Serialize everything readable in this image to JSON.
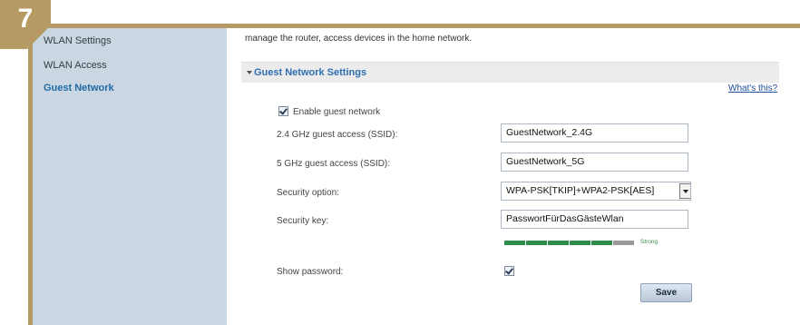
{
  "step_badge": "7",
  "sidebar": {
    "items": [
      {
        "label": "WLAN Settings"
      },
      {
        "label": "WLAN Access"
      },
      {
        "label": "Guest Network"
      }
    ]
  },
  "main": {
    "intro_text": "manage the router, access devices in the home network.",
    "section_title": "Guest Network Settings",
    "help_link": "What's this?",
    "enable_guest": {
      "label": "Enable guest network",
      "checked": true
    },
    "ssid_24": {
      "label": "2.4 GHz guest access (SSID):",
      "value": "GuestNetwork_2.4G"
    },
    "ssid_5": {
      "label": "5 GHz guest access (SSID):",
      "value": "GuestNetwork_5G"
    },
    "security_option": {
      "label": "Security option:",
      "value": "WPA-PSK[TKIP]+WPA2-PSK[AES]"
    },
    "security_key": {
      "label": "Security key:",
      "value": "PasswortFürDasGästeWlan"
    },
    "strength": {
      "label": "Strong",
      "level": 0.85
    },
    "show_password": {
      "label": "Show password:",
      "checked": true
    },
    "save_label": "Save"
  },
  "colors": {
    "frame": "#b59b63",
    "sidebar_bg": "#cad7e3",
    "accent": "#2f6fb1",
    "meter": "#2f8d4c"
  }
}
